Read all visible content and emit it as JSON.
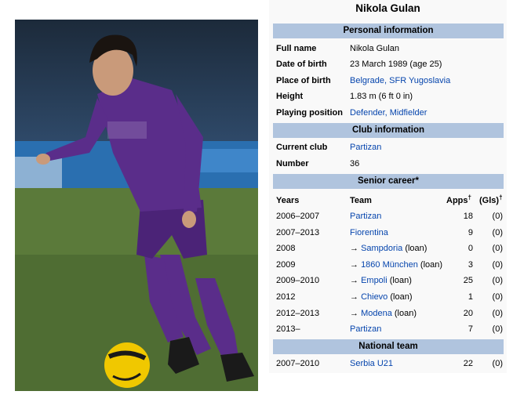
{
  "title": "Nikola Gulan",
  "sections": {
    "personal": "Personal information",
    "club": "Club information",
    "senior": "Senior career*",
    "national": "National team"
  },
  "personal": [
    {
      "label": "Full name",
      "value": "Nikola Gulan",
      "link": false
    },
    {
      "label": "Date of birth",
      "value": "23 March 1989 (age 25)",
      "link": false
    },
    {
      "label": "Place of birth",
      "value": "Belgrade, SFR Yugoslavia",
      "link": true
    },
    {
      "label": "Height",
      "value": "1.83 m (6 ft 0 in)",
      "link": false
    },
    {
      "label": "Playing position",
      "value": "Defender, Midfielder",
      "link": true
    }
  ],
  "club": [
    {
      "label": "Current club",
      "value": "Partizan",
      "link": true
    },
    {
      "label": "Number",
      "value": "36",
      "link": false
    }
  ],
  "career_headers": {
    "years": "Years",
    "team": "Team",
    "apps": "Apps",
    "gls": "(Gls)",
    "dagger": "†"
  },
  "career": [
    {
      "years": "2006–2007",
      "arrow": "",
      "team": "Partizan",
      "suffix": "",
      "apps": "18",
      "gls": "(0)"
    },
    {
      "years": "2007–2013",
      "arrow": "",
      "team": "Fiorentina",
      "suffix": "",
      "apps": "9",
      "gls": "(0)"
    },
    {
      "years": "2008",
      "arrow": "→ ",
      "team": "Sampdoria",
      "suffix": " (loan)",
      "apps": "0",
      "gls": "(0)"
    },
    {
      "years": "2009",
      "arrow": "→ ",
      "team": "1860 München",
      "suffix": " (loan)",
      "apps": "3",
      "gls": "(0)"
    },
    {
      "years": "2009–2010",
      "arrow": "→ ",
      "team": "Empoli",
      "suffix": " (loan)",
      "apps": "25",
      "gls": "(0)"
    },
    {
      "years": "2012",
      "arrow": "→ ",
      "team": "Chievo",
      "suffix": " (loan)",
      "apps": "1",
      "gls": "(0)"
    },
    {
      "years": "2012–2013",
      "arrow": "→ ",
      "team": "Modena",
      "suffix": " (loan)",
      "apps": "20",
      "gls": "(0)"
    },
    {
      "years": "2013–",
      "arrow": "",
      "team": "Partizan",
      "suffix": "",
      "apps": "7",
      "gls": "(0)"
    }
  ],
  "national": [
    {
      "years": "2007–2010",
      "arrow": "",
      "team": "Serbia U21",
      "suffix": "",
      "apps": "22",
      "gls": "(0)"
    }
  ],
  "colors": {
    "header_bg": "#b0c4de",
    "link": "#0645ad",
    "kit": "#5a2d8a"
  }
}
